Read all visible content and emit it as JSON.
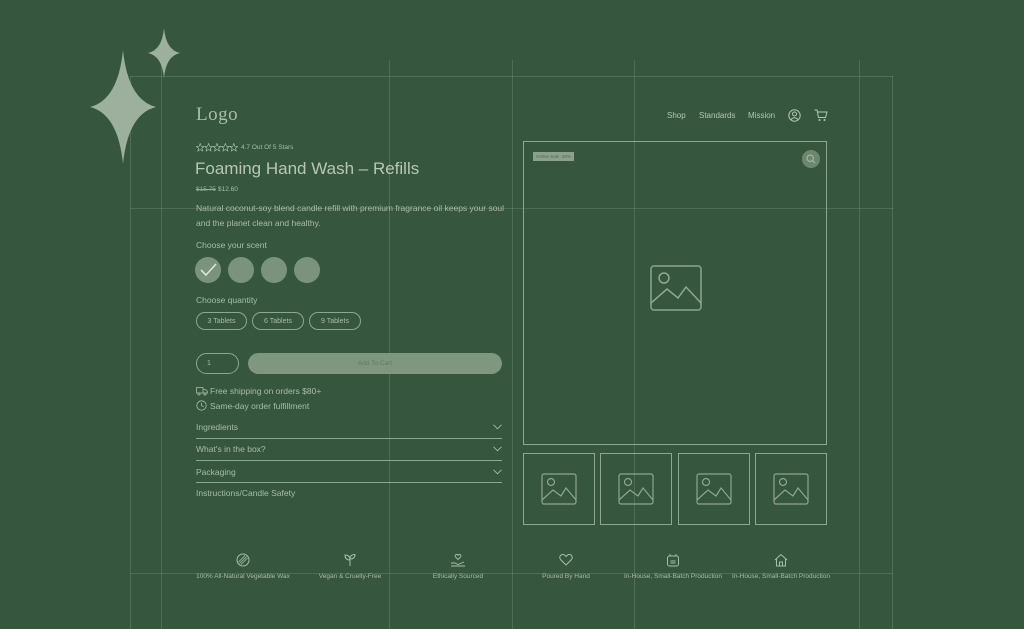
{
  "header": {
    "logo_text": "Logo",
    "nav": [
      {
        "label": "Shop"
      },
      {
        "label": "Standards"
      },
      {
        "label": "Mission"
      }
    ],
    "account_icon": "user-icon",
    "cart_icon": "cart-icon"
  },
  "product": {
    "rating_value": 4.7,
    "rating_text": "4.7 Out Of 5 Stars",
    "title": "Foaming Hand Wash – Refills",
    "old_price": "$15.75",
    "new_price": "$12.60",
    "description": "Natural coconut-soy blend candle refill with premium fragrance oil keeps your soul and the planet clean and healthy.",
    "scent_label": "Choose your scent",
    "scents_count_selected": 1,
    "quantity_label": "Choose quantity",
    "quantity_options": [
      "3 Tablets",
      "6 Tablets",
      "9 Tablets"
    ],
    "qty_value": "1",
    "add_to_cart": "Add To Cart",
    "shipping": "Free shipping on orders $80+",
    "fulfillment": "Same-day order fulfillment",
    "accordion": [
      "Ingredients",
      "What's in the box?",
      "Packaging",
      "Instructions/Candle Safety"
    ]
  },
  "gallery": {
    "badge": "Online Sale -20%",
    "zoom_icon": "search-icon",
    "thumbnail_count": 4
  },
  "features": [
    {
      "icon": "wax-icon",
      "label": "100% All-Natural Vegetable Wax"
    },
    {
      "icon": "sprout-icon",
      "label": "Vegan & Cruelty-Free"
    },
    {
      "icon": "hand-heart-icon",
      "label": "Ethically Sourced"
    },
    {
      "icon": "heart-icon",
      "label": "Poured By Hand"
    },
    {
      "icon": "factory-icon",
      "label": "In-House, Small-Batch Production"
    },
    {
      "icon": "house-icon",
      "label": "In-House, Small-Batch Production"
    }
  ],
  "colors": {
    "background": "#36573e",
    "foreground": "#a9bca9",
    "button": "#7f977f"
  }
}
